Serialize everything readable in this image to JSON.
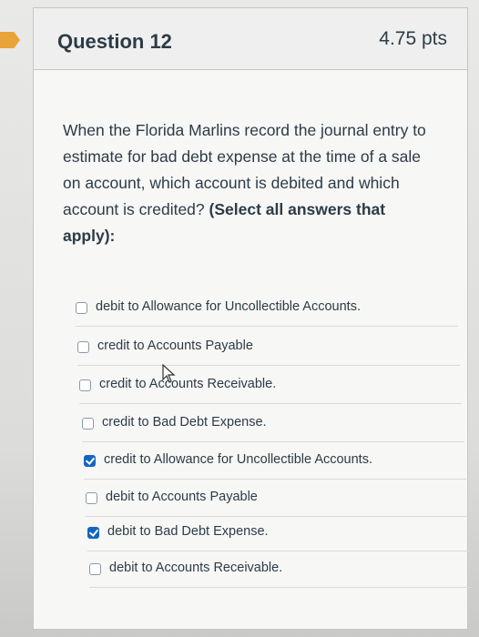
{
  "question": {
    "title": "Question 12",
    "points": "4.75 pts",
    "text_main": "When the Florida Marlins record the journal entry to estimate for bad debt expense at the time of a sale on account, which account is debited and which account is credited? ",
    "text_bold": "(Select all answers that apply):"
  },
  "answers": [
    {
      "label": "debit to Allowance for Uncollectible Accounts.",
      "checked": false
    },
    {
      "label": "credit to Accounts Payable",
      "checked": false
    },
    {
      "label": "credit to Accounts Receivable.",
      "checked": false
    },
    {
      "label": "credit to Bad Debt Expense.",
      "checked": false
    },
    {
      "label": "credit to Allowance for Uncollectible Accounts.",
      "checked": true
    },
    {
      "label": "debit to Accounts Payable",
      "checked": false
    },
    {
      "label": "debit to Bad Debt Expense.",
      "checked": true
    },
    {
      "label": "debit to Accounts Receivable.",
      "checked": false
    }
  ],
  "colors": {
    "accent": "#1565c0",
    "flag": "#e8a33a",
    "text": "#2d3b45"
  }
}
